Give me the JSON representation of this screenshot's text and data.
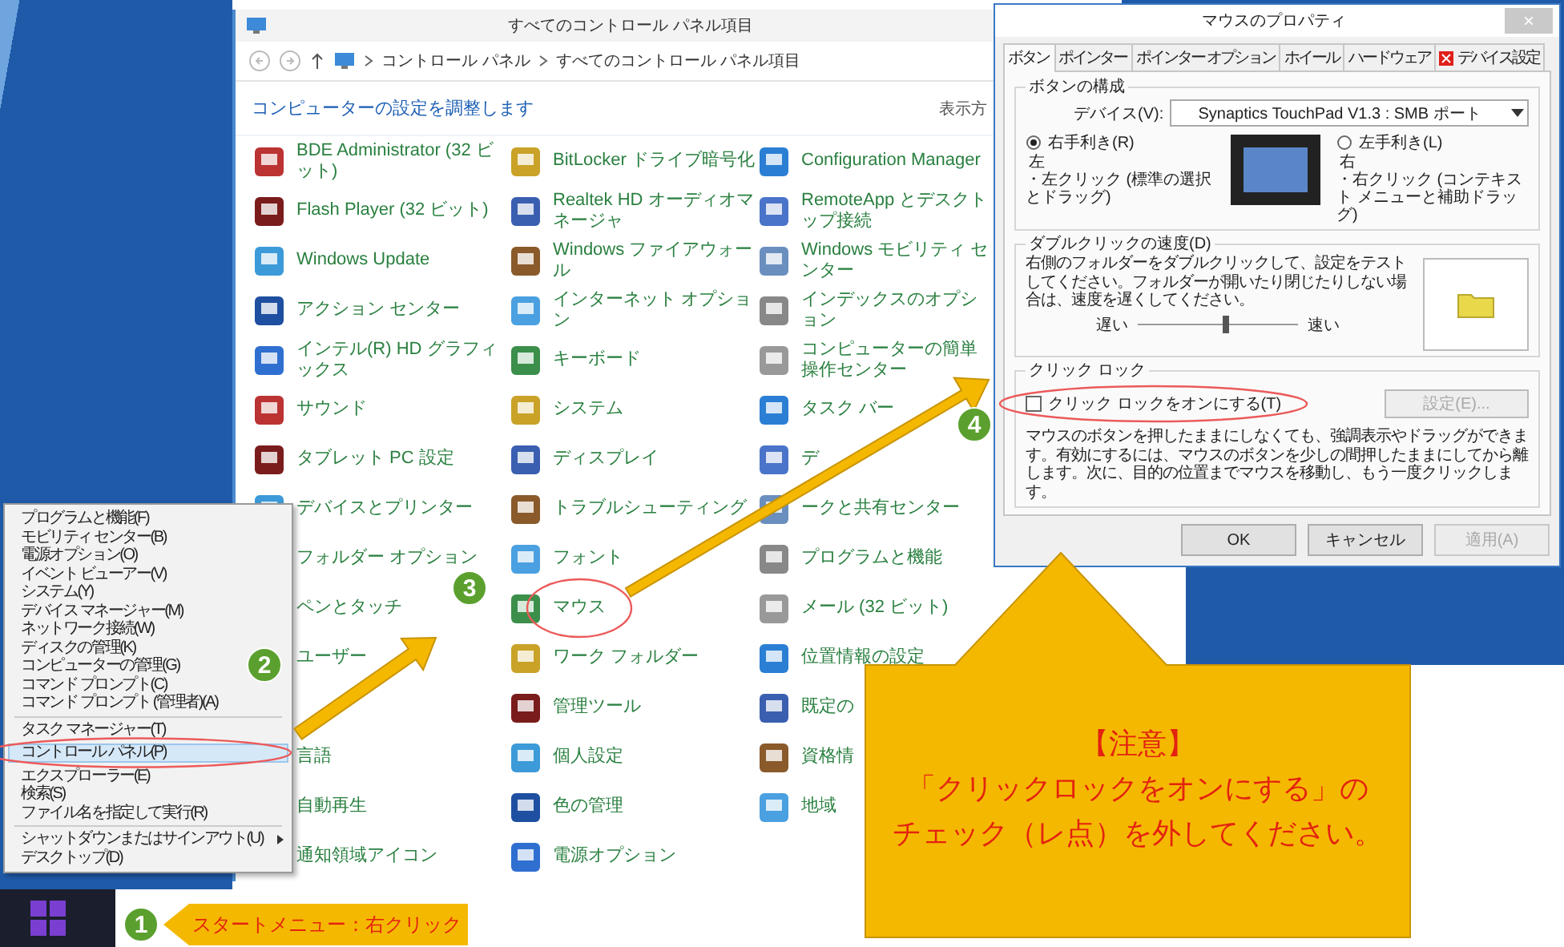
{
  "control_panel": {
    "title": "すべてのコントロール パネル項目",
    "breadcrumb": [
      "コントロール パネル",
      "すべてのコントロール パネル項目"
    ],
    "heading": "コンピューターの設定を調整します",
    "view_label": "表示方",
    "rows": [
      [
        "BDE Administrator (32 ビット)",
        "BitLocker ドライブ暗号化",
        "Configuration Manager"
      ],
      [
        "Flash Player (32 ビット)",
        "Realtek HD オーディオマネージャ",
        "RemoteApp とデスクトップ接続"
      ],
      [
        "Windows Update",
        "Windows ファイアウォール",
        "Windows モビリティ センター"
      ],
      [
        "アクション センター",
        "インターネット オプション",
        "インデックスのオプション"
      ],
      [
        "インテル(R) HD グラフィックス",
        "キーボード",
        "コンピューターの簡単操作センター"
      ],
      [
        "サウンド",
        "システム",
        "タスク バー"
      ],
      [
        "タブレット PC 設定",
        "ディスプレイ",
        "デ"
      ],
      [
        "デバイスとプリンター",
        "トラブルシューティング",
        "ークと共有センター"
      ],
      [
        "フォルダー オプション",
        "フォント",
        "プログラムと機能"
      ],
      [
        "ペンとタッチ",
        "マウス",
        "メール (32 ビット)"
      ],
      [
        "ユーザー",
        "ワーク フォルダー",
        "位置情報の設定"
      ],
      [
        null,
        "管理ツール",
        "既定の"
      ],
      [
        "言語",
        "個人設定",
        "資格情"
      ],
      [
        "自動再生",
        "色の管理",
        "地域"
      ],
      [
        "通知領域アイコン",
        "電源オプション",
        null
      ]
    ]
  },
  "context_menu": {
    "items": [
      {
        "kind": "item",
        "label": "プログラムと機能(F)",
        "selected": false
      },
      {
        "kind": "item",
        "label": "モビリティ センター(B)",
        "selected": false
      },
      {
        "kind": "item",
        "label": "電源オプション(O)",
        "selected": false
      },
      {
        "kind": "item",
        "label": "イベント ビューアー(V)",
        "selected": false
      },
      {
        "kind": "item",
        "label": "システム(Y)",
        "selected": false
      },
      {
        "kind": "item",
        "label": "デバイス マネージャー(M)",
        "selected": false
      },
      {
        "kind": "item",
        "label": "ネットワーク接続(W)",
        "selected": false
      },
      {
        "kind": "item",
        "label": "ディスクの管理(K)",
        "selected": false
      },
      {
        "kind": "item",
        "label": "コンピューターの管理(G)",
        "selected": false
      },
      {
        "kind": "item",
        "label": "コマンド プロンプト(C)",
        "selected": false
      },
      {
        "kind": "item",
        "label": "コマンド プロンプト (管理者)(A)",
        "selected": false
      },
      {
        "kind": "separator"
      },
      {
        "kind": "item",
        "label": "タスク マネージャー(T)",
        "selected": false
      },
      {
        "kind": "item",
        "label": "コントロール パネル(P)",
        "selected": true
      },
      {
        "kind": "item",
        "label": "エクスプローラー(E)",
        "selected": false
      },
      {
        "kind": "item",
        "label": "検索(S)",
        "selected": false
      },
      {
        "kind": "item",
        "label": "ファイル名を指定して実行(R)",
        "selected": false
      },
      {
        "kind": "separator"
      },
      {
        "kind": "submenu",
        "label": "シャットダウンまたはサインアウト(U)",
        "selected": false
      },
      {
        "kind": "item",
        "label": "デスクトップ(D)",
        "selected": false
      }
    ]
  },
  "dialog": {
    "title": "マウスのプロパティ",
    "close": "×",
    "tabs": [
      {
        "label": "ボタン",
        "selected": true,
        "has_icon": false
      },
      {
        "label": "ポインター",
        "selected": false,
        "has_icon": false
      },
      {
        "label": "ポインター オプション",
        "selected": false,
        "has_icon": false
      },
      {
        "label": "ホイール",
        "selected": false,
        "has_icon": false
      },
      {
        "label": "ハードウェア",
        "selected": false,
        "has_icon": false
      },
      {
        "label": "デバイス設定",
        "selected": false,
        "has_icon": true
      }
    ],
    "button_config": {
      "legend": "ボタンの構成",
      "device_label": "デバイス(V):",
      "device_value": "Synaptics TouchPad V1.3 : SMB ポート",
      "options": [
        {
          "label": "右手利き(R)",
          "selected": true,
          "side": "左",
          "desc": "・左クリック (標準の選択とドラッグ)"
        },
        {
          "label": "左手利き(L)",
          "selected": false,
          "side": "右",
          "desc": "・右クリック (コンテキスト メニューと補助ドラッグ)"
        }
      ]
    },
    "double_click": {
      "legend": "ダブルクリックの速度(D)",
      "text": "右側のフォルダーをダブルクリックして、設定をテストしてください。フォルダーが開いたり閉じたりしない場合は、速度を遅くしてください。",
      "slow": "遅い",
      "fast": "速い",
      "level": 0.55
    },
    "click_lock": {
      "legend": "クリック ロック",
      "checkbox": {
        "label": "クリック ロックをオンにする(T)",
        "checked": false
      },
      "settings_button": {
        "label": "設定(E)...",
        "disabled": true
      },
      "text": "マウスのボタンを押したままにしなくても、強調表示やドラッグができます。有効にするには、マウスのボタンを少しの間押したままにしてから離します。次に、目的の位置までマウスを移動し、もう一度クリックします。"
    },
    "buttons": [
      {
        "label": "OK",
        "disabled": false
      },
      {
        "label": "キャンセル",
        "disabled": false
      },
      {
        "label": "適用(A)",
        "disabled": true
      }
    ]
  },
  "annotations": {
    "steps": [
      "1",
      "2",
      "3",
      "4"
    ],
    "start_label": "スタートメニュー：右クリック",
    "note": {
      "title": "【注意】",
      "lines": [
        "「クリックロックをオンにする」の",
        "チェック（レ点）を外してください。"
      ]
    }
  }
}
